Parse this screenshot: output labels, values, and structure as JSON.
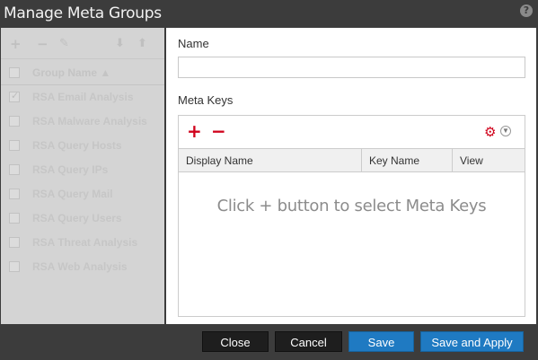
{
  "window": {
    "title": "Manage Meta Groups",
    "help_icon": "?"
  },
  "left_panel": {
    "toolbar_icons": [
      "plus-icon",
      "minus-icon",
      "edit-icon",
      "import-icon",
      "export-icon"
    ],
    "header": "Group Name ▲",
    "groups": [
      {
        "label": "RSA Email Analysis",
        "checked": true
      },
      {
        "label": "RSA Malware Analysis",
        "checked": false
      },
      {
        "label": "RSA Query Hosts",
        "checked": false
      },
      {
        "label": "RSA Query IPs",
        "checked": false
      },
      {
        "label": "RSA Query Mail",
        "checked": false
      },
      {
        "label": "RSA Query Users",
        "checked": false
      },
      {
        "label": "RSA Threat Analysis",
        "checked": false
      },
      {
        "label": "RSA Web Analysis",
        "checked": false
      }
    ]
  },
  "form": {
    "name_label": "Name",
    "name_value": "",
    "meta_keys_label": "Meta Keys",
    "columns": [
      "Display Name",
      "Key Name",
      "View"
    ],
    "empty_message": "Click + button to select Meta Keys"
  },
  "footer": {
    "close_label": "Close",
    "cancel_label": "Cancel",
    "save_label": "Save",
    "save_apply_label": "Save and Apply"
  },
  "colors": {
    "accent_red": "#d0021b",
    "button_blue": "#1f7ac2",
    "button_dark": "#1e1e1e"
  }
}
